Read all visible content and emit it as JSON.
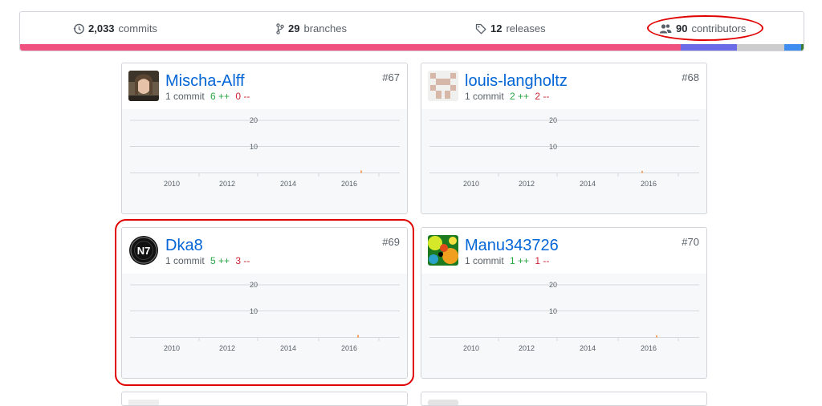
{
  "summary": {
    "commits": {
      "count": "2,033",
      "label": "commits",
      "icon": "history-icon"
    },
    "branches": {
      "count": "29",
      "label": "branches",
      "icon": "git-branch-icon"
    },
    "releases": {
      "count": "12",
      "label": "releases",
      "icon": "tag-icon"
    },
    "contributors": {
      "count": "90",
      "label": "contributors",
      "icon": "people-icon"
    }
  },
  "language_bar": [
    {
      "color": "#f1517f",
      "fraction": 0.843
    },
    {
      "color": "#6b6be8",
      "fraction": 0.072
    },
    {
      "color": "#cccccc",
      "fraction": 0.06
    },
    {
      "color": "#3d8ef0",
      "fraction": 0.022
    },
    {
      "color": "#3c7a2f",
      "fraction": 0.003
    }
  ],
  "axis": {
    "y_ticks": [
      "20",
      "10"
    ],
    "x_ticks": [
      "2010",
      "2012",
      "2014",
      "2016"
    ]
  },
  "contributors": [
    {
      "login": "Mischa-Alff",
      "rank": "#67",
      "commits": "1 commit",
      "additions": "6 ++",
      "deletions": "0 --"
    },
    {
      "login": "louis-langholtz",
      "rank": "#68",
      "commits": "1 commit",
      "additions": "2 ++",
      "deletions": "2 --"
    },
    {
      "login": "Dka8",
      "rank": "#69",
      "commits": "1 commit",
      "additions": "5 ++",
      "deletions": "3 --"
    },
    {
      "login": "Manu343726",
      "rank": "#70",
      "commits": "1 commit",
      "additions": "1 ++",
      "deletions": "1 --"
    }
  ],
  "annotation_color": "#e00000"
}
